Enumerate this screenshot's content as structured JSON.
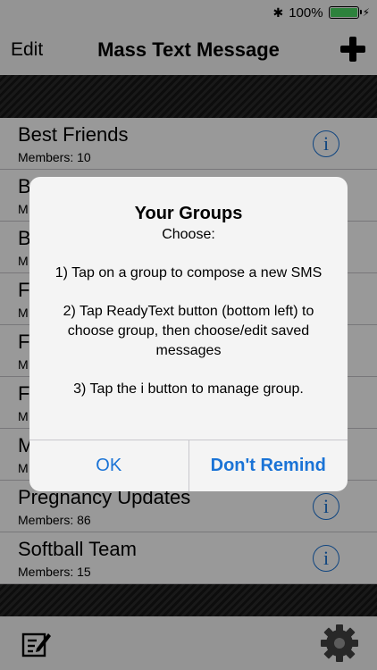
{
  "status_bar": {
    "bluetooth_icon": "bluetooth-icon",
    "battery_percent": "100%",
    "battery_level": 1.0,
    "battery_color": "#4cd964",
    "charging_icon": "lightning-bolt-icon"
  },
  "navbar": {
    "edit_label": "Edit",
    "title": "Mass Text Message",
    "add_icon": "plus-icon"
  },
  "groups": [
    {
      "name": "Best Friends",
      "members": "Members: 10"
    },
    {
      "name": "B",
      "members": "M"
    },
    {
      "name": "B",
      "members": "M"
    },
    {
      "name": "F",
      "members": "M"
    },
    {
      "name": "F",
      "members": "M"
    },
    {
      "name": "F",
      "members": "M"
    },
    {
      "name": "M",
      "members": "M"
    },
    {
      "name": "Pregnancy Updates",
      "members": "Members: 86"
    },
    {
      "name": "Softball Team",
      "members": "Members: 15"
    }
  ],
  "info_glyph": "i",
  "dialog": {
    "title": "Your Groups",
    "subtitle": "Choose:",
    "step1": "1) Tap on a group to compose a new SMS",
    "step2": "2) Tap ReadyText button (bottom left) to choose group, then choose/edit saved messages",
    "step3": "3) Tap the i button to manage group.",
    "ok_label": "OK",
    "dont_remind_label": "Don't Remind"
  },
  "toolbar": {
    "compose_icon": "compose-icon",
    "settings_icon": "gear-icon"
  },
  "colors": {
    "accent": "#1a73d6",
    "bar_background": "#f7f7f7",
    "stripe_dark": "#1e1e1e"
  }
}
